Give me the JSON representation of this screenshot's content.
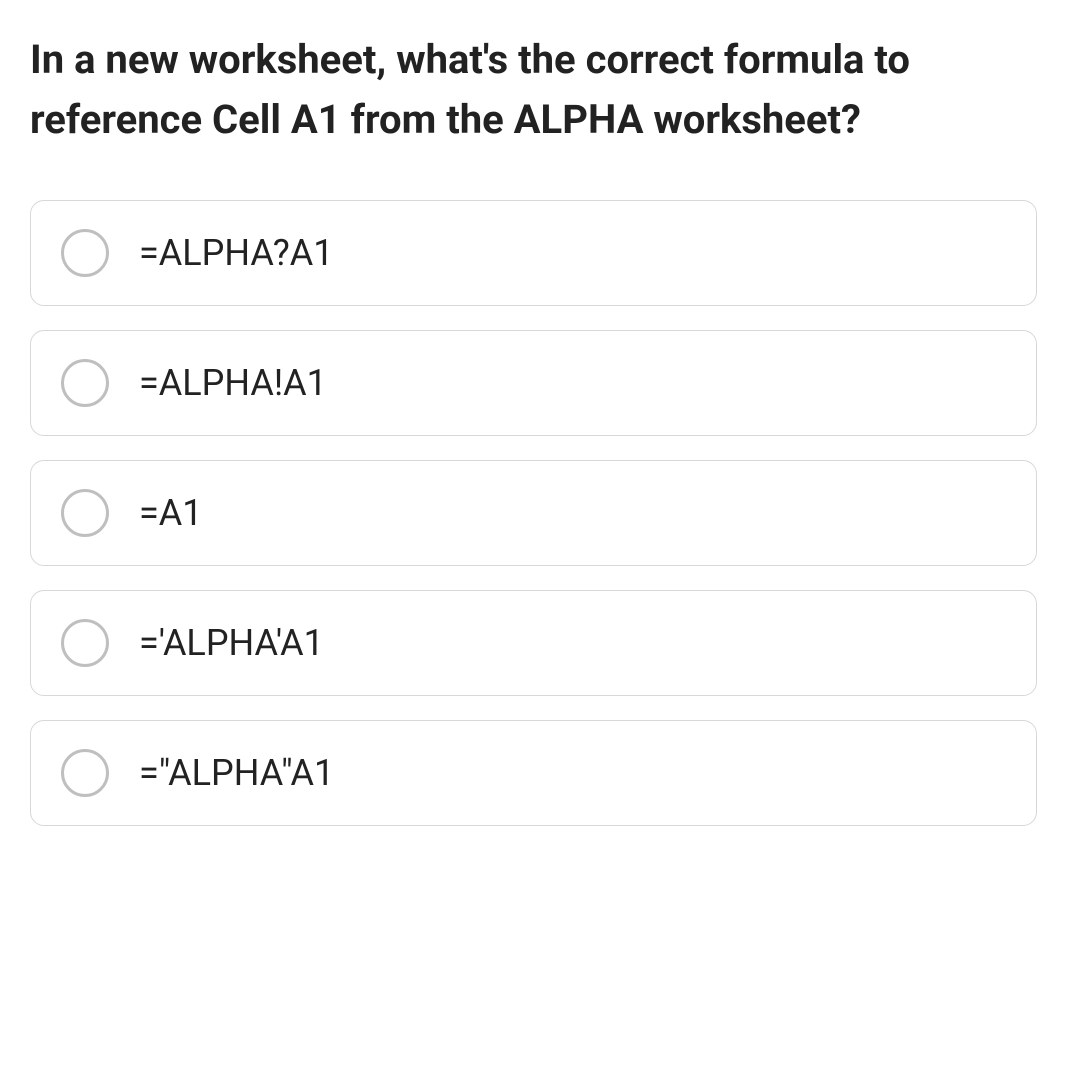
{
  "question": "In a new worksheet, what's the correct formula to reference Cell A1 from the ALPHA worksheet?",
  "options": [
    {
      "label": "=ALPHA?A1"
    },
    {
      "label": "=ALPHA!A1"
    },
    {
      "label": "=A1"
    },
    {
      "label": "='ALPHA'A1"
    },
    {
      "label": "=\"ALPHA\"A1"
    }
  ]
}
